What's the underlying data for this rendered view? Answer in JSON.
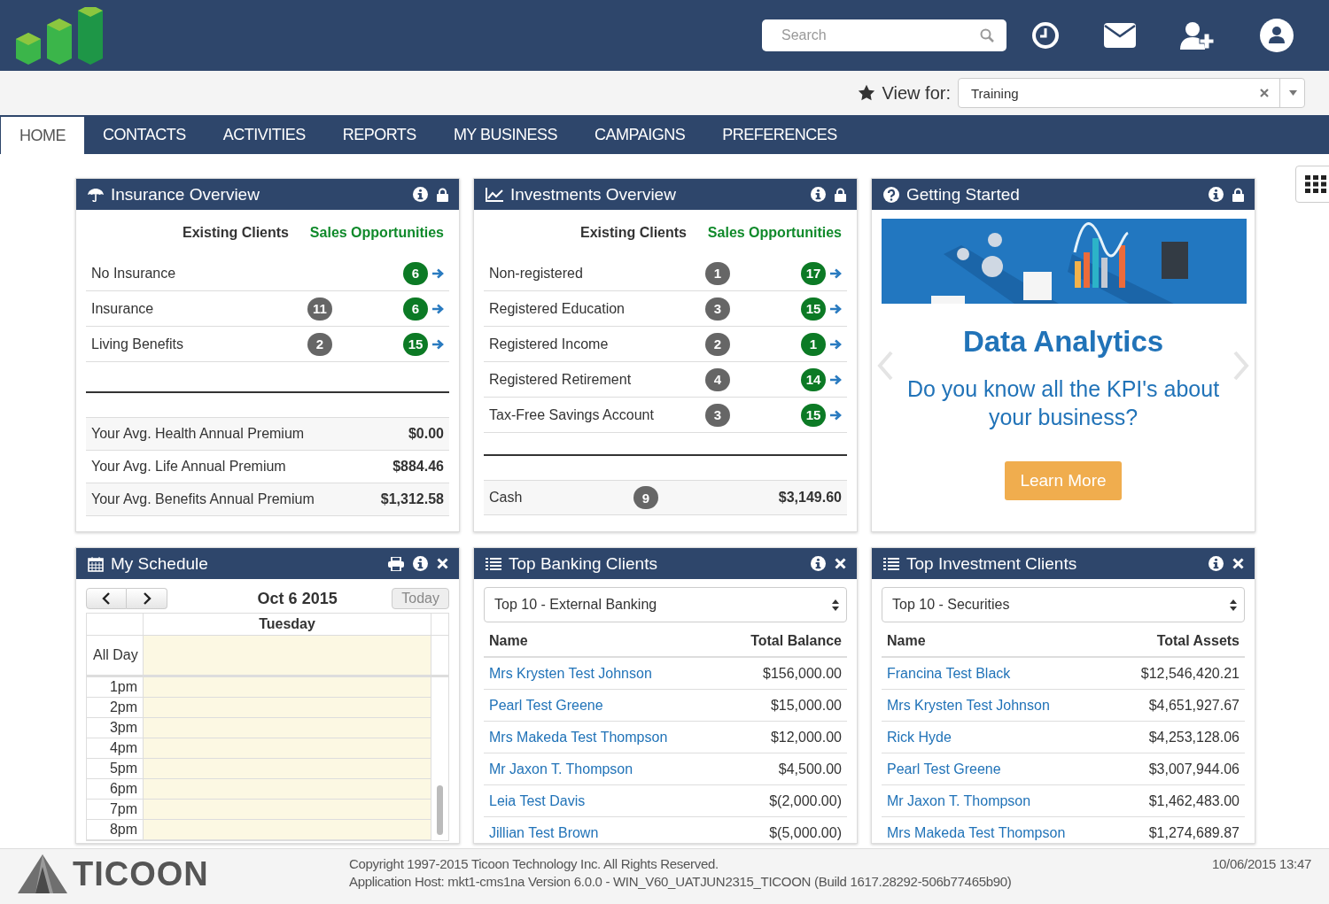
{
  "header": {
    "search": {
      "placeholder": "Search"
    }
  },
  "view_for": {
    "label": "View for:",
    "value": "Training"
  },
  "nav": [
    {
      "label": "HOME",
      "selected": true
    },
    {
      "label": "CONTACTS",
      "selected": false
    },
    {
      "label": "ACTIVITIES",
      "selected": false
    },
    {
      "label": "REPORTS",
      "selected": false
    },
    {
      "label": "MY BUSINESS",
      "selected": false
    },
    {
      "label": "CAMPAIGNS",
      "selected": false
    },
    {
      "label": "PREFERENCES",
      "selected": false
    }
  ],
  "insurance": {
    "title": "Insurance Overview",
    "col_existing": "Existing Clients",
    "col_sales": "Sales Opportunities",
    "rows": [
      {
        "name": "No Insurance",
        "opportunities": "6"
      },
      {
        "name": "Insurance",
        "existing": "11",
        "opportunities": "6"
      },
      {
        "name": "Living Benefits",
        "existing": "2",
        "opportunities": "15"
      }
    ],
    "premiums": [
      {
        "label": "Your Avg. Health Annual Premium",
        "value": "$0.00"
      },
      {
        "label": "Your Avg. Life Annual Premium",
        "value": "$884.46"
      },
      {
        "label": "Your Avg. Benefits Annual Premium",
        "value": "$1,312.58"
      }
    ]
  },
  "investments": {
    "title": "Investments Overview",
    "col_existing": "Existing Clients",
    "col_sales": "Sales Opportunities",
    "rows": [
      {
        "name": "Non-registered",
        "existing": "1",
        "opportunities": "17"
      },
      {
        "name": "Registered Education",
        "existing": "3",
        "opportunities": "15"
      },
      {
        "name": "Registered Income",
        "existing": "2",
        "opportunities": "1"
      },
      {
        "name": "Registered Retirement",
        "existing": "4",
        "opportunities": "14"
      },
      {
        "name": "Tax-Free Savings Account",
        "existing": "3",
        "opportunities": "15"
      }
    ],
    "cash": {
      "label": "Cash",
      "count": "9",
      "value": "$3,149.60"
    }
  },
  "getting_started": {
    "title": "Getting Started",
    "heading": "Data Analytics",
    "text": "Do you know all the KPI's about your business?",
    "button": "Learn More"
  },
  "schedule": {
    "title": "My Schedule",
    "date": "Oct 6 2015",
    "today": "Today",
    "day": "Tuesday",
    "all_day": "All Day",
    "hours": [
      "1pm",
      "2pm",
      "3pm",
      "4pm",
      "5pm",
      "6pm",
      "7pm",
      "8pm"
    ]
  },
  "banking": {
    "title": "Top Banking Clients",
    "select": "Top 10 - External Banking",
    "columns": [
      "Name",
      "Total Balance"
    ],
    "rows": [
      {
        "name": "Mrs Krysten Test Johnson",
        "amount": "$156,000.00"
      },
      {
        "name": "Pearl Test Greene",
        "amount": "$15,000.00"
      },
      {
        "name": "Mrs Makeda Test Thompson",
        "amount": "$12,000.00"
      },
      {
        "name": "Mr Jaxon T. Thompson",
        "amount": "$4,500.00"
      },
      {
        "name": "Leia Test Davis",
        "amount": "$(2,000.00)"
      },
      {
        "name": "Jillian Test Brown",
        "amount": "$(5,000.00)"
      }
    ]
  },
  "investment_clients": {
    "title": "Top Investment Clients",
    "select": "Top 10 - Securities",
    "columns": [
      "Name",
      "Total Assets"
    ],
    "rows": [
      {
        "name": "Francina Test Black",
        "amount": "$12,546,420.21"
      },
      {
        "name": "Mrs Krysten Test Johnson",
        "amount": "$4,651,927.67"
      },
      {
        "name": "Rick Hyde",
        "amount": "$4,253,128.06"
      },
      {
        "name": "Pearl Test Greene",
        "amount": "$3,007,944.06"
      },
      {
        "name": "Mr Jaxon T. Thompson",
        "amount": "$1,462,483.00"
      },
      {
        "name": "Mrs Makeda Test Thompson",
        "amount": "$1,274,689.87"
      }
    ]
  },
  "footer": {
    "logo": "TICOON",
    "copyright": "Copyright 1997-2015 Ticoon Technology Inc. All Rights Reserved.",
    "host": "Application Host: mkt1-cms1na Version 6.0.0 - WIN_V60_UATJUN2315_TICOON (Build 1617.28292-506b77465b90)",
    "timestamp": "10/06/2015 13:47"
  }
}
